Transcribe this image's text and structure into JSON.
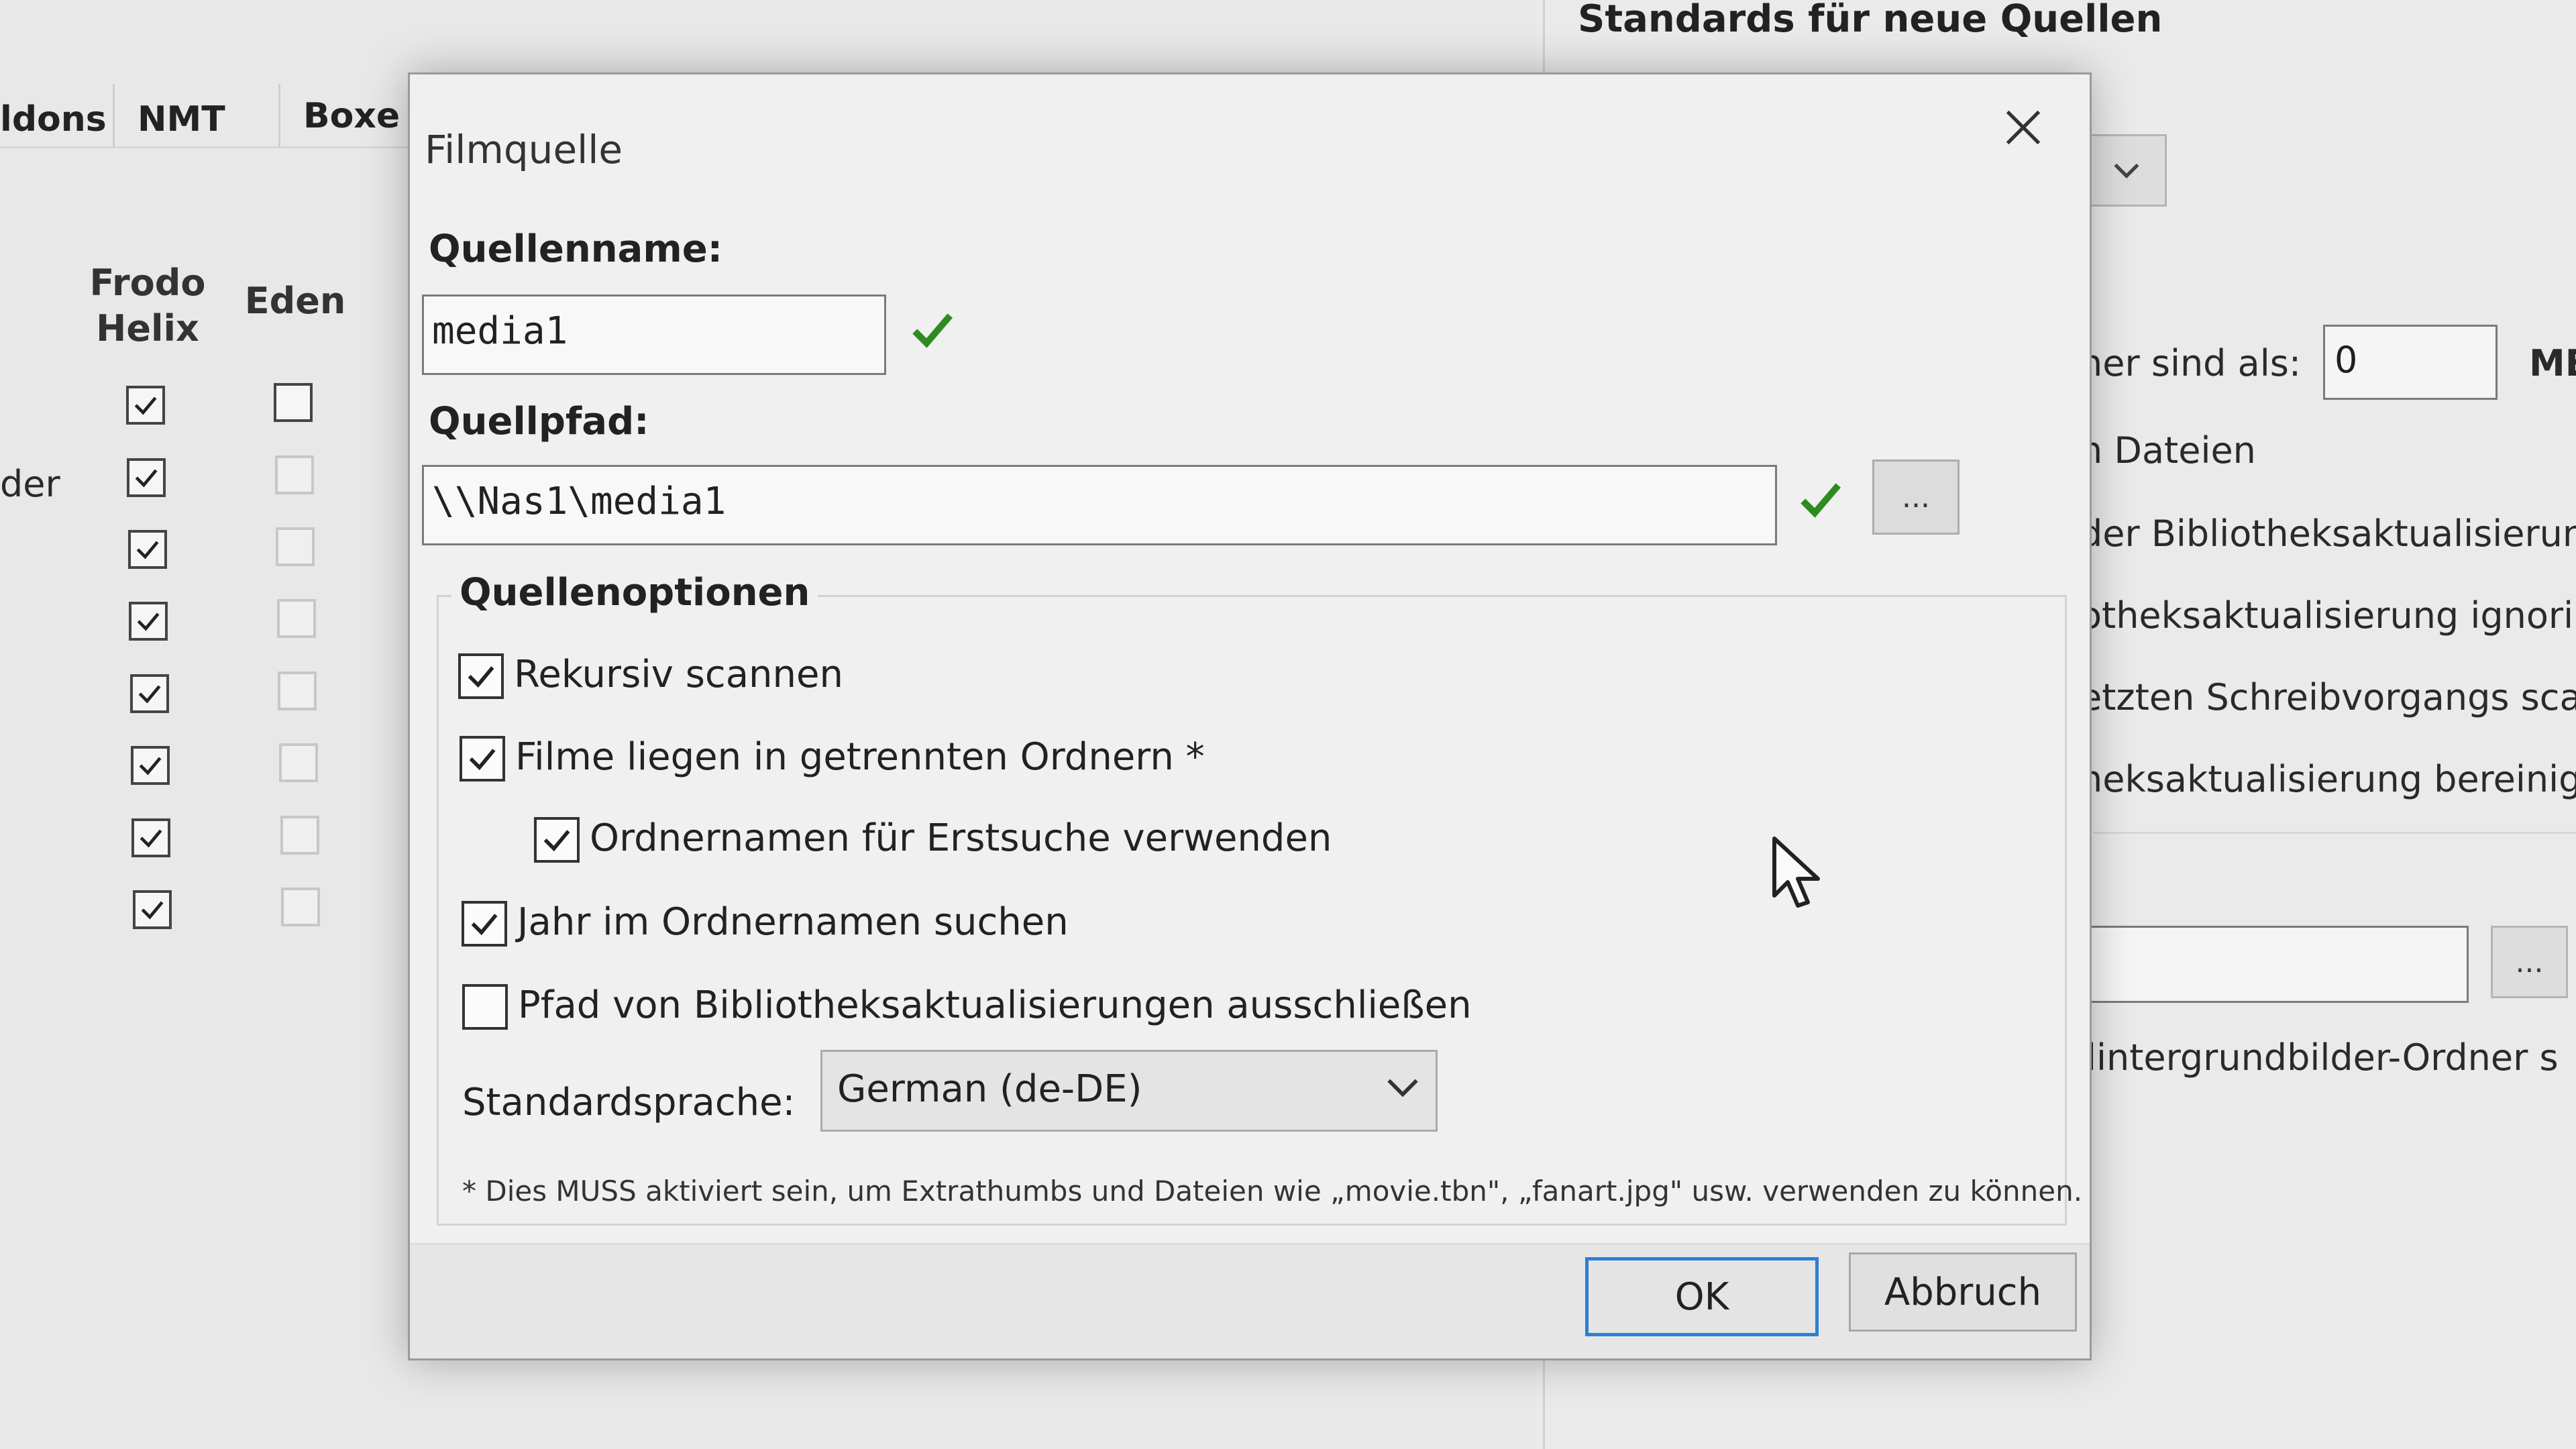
{
  "background": {
    "tabs": [
      "ldons",
      "NMT",
      "Boxe"
    ],
    "columns": {
      "frodo_helix": "Frodo\nHelix",
      "eden": "Eden"
    },
    "row_label": "der",
    "frodo_checked": [
      true,
      true,
      true,
      true,
      true,
      true,
      true,
      true
    ],
    "eden_checked": [
      false,
      false,
      false,
      false,
      false,
      false,
      false,
      false
    ],
    "right_panel": {
      "header": "Standards für neue Quellen",
      "size_label": "ner sind als:",
      "size_value": "0",
      "size_unit": "ME",
      "lines": [
        "n Dateien",
        "der Bibliotheksaktualisierun",
        "otheksaktualisierung ignori",
        "etzten Schreibvorgangs sca",
        "heksaktualisierung bereinig"
      ],
      "browse_label": "...",
      "fanart_label": "lintergrundbilder-Ordner s"
    }
  },
  "dialog": {
    "title": "Filmquelle",
    "source_name_label": "Quellenname:",
    "source_name_value": "media1",
    "source_path_label": "Quellpfad:",
    "source_path_value": "\\\\Nas1\\media1",
    "browse_label": "...",
    "options_title": "Quellenoptionen",
    "options": [
      {
        "label": "Rekursiv scannen",
        "checked": true
      },
      {
        "label": "Filme liegen in getrennten Ordnern *",
        "checked": true
      },
      {
        "label": "Ordnernamen für Erstsuche verwenden",
        "checked": true
      },
      {
        "label": "Jahr im Ordnernamen suchen",
        "checked": true
      },
      {
        "label": "Pfad von Bibliotheksaktualisierungen ausschließen",
        "checked": false
      }
    ],
    "language_label": "Standardsprache:",
    "language_value": "German (de-DE)",
    "note": "* Dies MUSS aktiviert sein, um Extrathumbs und Dateien wie „movie.tbn\", „fanart.jpg\" usw. verwenden zu können.",
    "ok_label": "OK",
    "cancel_label": "Abbruch"
  },
  "colors": {
    "check_green": "#2e8b1f",
    "ok_border": "#2c7fd6"
  }
}
